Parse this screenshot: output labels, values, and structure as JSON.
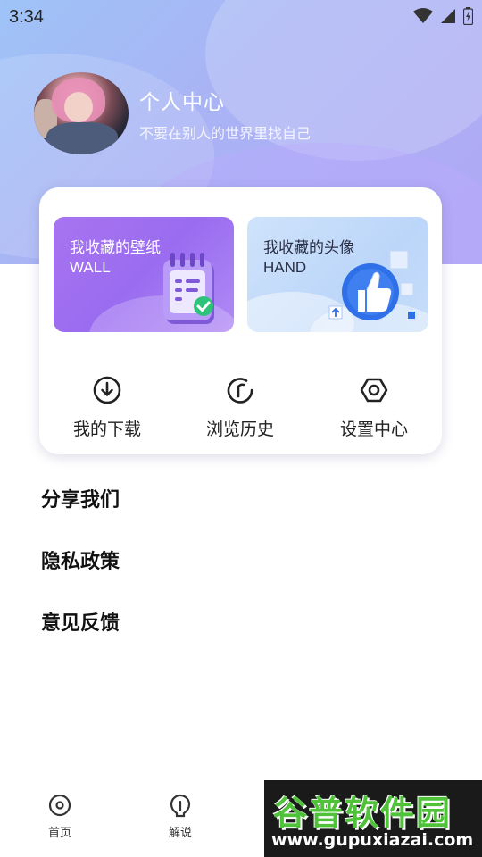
{
  "status_bar": {
    "time": "3:34"
  },
  "profile": {
    "name": "个人中心",
    "motto": "不要在别人的世界里找自己"
  },
  "collections": [
    {
      "title": "我收藏的壁纸",
      "subtitle": "WALL"
    },
    {
      "title": "我收藏的头像",
      "subtitle": "HAND"
    }
  ],
  "quick_actions": [
    {
      "label": "我的下载",
      "icon": "download-circle-icon"
    },
    {
      "label": "浏览历史",
      "icon": "history-icon"
    },
    {
      "label": "设置中心",
      "icon": "settings-icon"
    }
  ],
  "menu": [
    {
      "label": "分享我们"
    },
    {
      "label": "隐私政策"
    },
    {
      "label": "意见反馈"
    }
  ],
  "tabbar": [
    {
      "label": "首页",
      "icon": "home-icon"
    },
    {
      "label": "解说",
      "icon": "explain-icon"
    }
  ],
  "watermark": {
    "title": "谷普软件园",
    "url": "www.gupuxiazai.com"
  },
  "colors": {
    "accent_purple": "#a874f0",
    "accent_blue": "#2f6fe8",
    "hero_gradient_start": "#9ec3f7",
    "hero_gradient_end": "#b0a8f4"
  }
}
